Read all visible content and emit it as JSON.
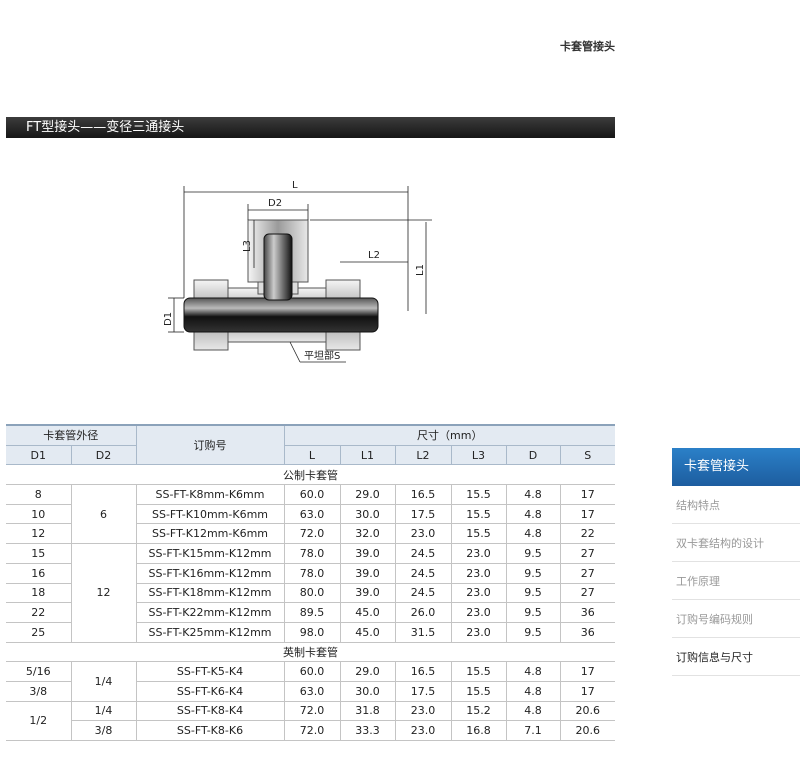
{
  "page_title": "卡套管接头",
  "banner_title": "FT型接头——变径三通接头",
  "drawing_labels": {
    "L": "L",
    "D2": "D2",
    "L3": "L3",
    "L2": "L2",
    "L1": "L1",
    "D1": "D1",
    "S": "平坦部S"
  },
  "table": {
    "header": {
      "tube_od": "卡套管外径",
      "order_no": "订购号",
      "size": "尺寸（mm）",
      "d1": "D1",
      "d2": "D2",
      "l": "L",
      "l1": "L1",
      "l2": "L2",
      "l3": "L3",
      "d": "D",
      "s": "S"
    },
    "metric_label": "公制卡套管",
    "imperial_label": "英制卡套管",
    "metric_rows": [
      {
        "d1": "8",
        "order": "SS-FT-K8mm-K6mm",
        "l": "60.0",
        "l1": "29.0",
        "l2": "16.5",
        "l3": "15.5",
        "d": "4.8",
        "s": "17"
      },
      {
        "d1": "10",
        "order": "SS-FT-K10mm-K6mm",
        "l": "63.0",
        "l1": "30.0",
        "l2": "17.5",
        "l3": "15.5",
        "d": "4.8",
        "s": "17"
      },
      {
        "d1": "12",
        "order": "SS-FT-K12mm-K6mm",
        "l": "72.0",
        "l1": "32.0",
        "l2": "23.0",
        "l3": "15.5",
        "d": "4.8",
        "s": "22"
      },
      {
        "d1": "15",
        "order": "SS-FT-K15mm-K12mm",
        "l": "78.0",
        "l1": "39.0",
        "l2": "24.5",
        "l3": "23.0",
        "d": "9.5",
        "s": "27"
      },
      {
        "d1": "16",
        "order": "SS-FT-K16mm-K12mm",
        "l": "78.0",
        "l1": "39.0",
        "l2": "24.5",
        "l3": "23.0",
        "d": "9.5",
        "s": "27"
      },
      {
        "d1": "18",
        "order": "SS-FT-K18mm-K12mm",
        "l": "80.0",
        "l1": "39.0",
        "l2": "24.5",
        "l3": "23.0",
        "d": "9.5",
        "s": "27"
      },
      {
        "d1": "22",
        "order": "SS-FT-K22mm-K12mm",
        "l": "89.5",
        "l1": "45.0",
        "l2": "26.0",
        "l3": "23.0",
        "d": "9.5",
        "s": "36"
      },
      {
        "d1": "25",
        "order": "SS-FT-K25mm-K12mm",
        "l": "98.0",
        "l1": "45.0",
        "l2": "31.5",
        "l3": "23.0",
        "d": "9.5",
        "s": "36"
      }
    ],
    "metric_d2_groups": [
      "6",
      "12"
    ],
    "imperial_rows": [
      {
        "order": "SS-FT-K5-K4",
        "l": "60.0",
        "l1": "29.0",
        "l2": "16.5",
        "l3": "15.5",
        "d": "4.8",
        "s": "17"
      },
      {
        "order": "SS-FT-K6-K4",
        "l": "63.0",
        "l1": "30.0",
        "l2": "17.5",
        "l3": "15.5",
        "d": "4.8",
        "s": "17"
      },
      {
        "order": "SS-FT-K8-K4",
        "l": "72.0",
        "l1": "31.8",
        "l2": "23.0",
        "l3": "15.2",
        "d": "4.8",
        "s": "20.6"
      },
      {
        "order": "SS-FT-K8-K6",
        "l": "72.0",
        "l1": "33.3",
        "l2": "23.0",
        "l3": "16.8",
        "d": "7.1",
        "s": "20.6"
      }
    ],
    "imperial_d1": [
      "5/16",
      "3/8",
      "1/2"
    ],
    "imperial_d2": [
      "1/4",
      "1/4",
      "3/8"
    ]
  },
  "sidebar": {
    "active": "卡套管接头",
    "items": [
      "结构特点",
      "双卡套结构的设计",
      "工作原理",
      "订购号编码规则",
      "订购信息与尺寸"
    ]
  },
  "colors": {
    "banner": "#222222",
    "header_bg": "#e3eaf2",
    "sidebar_active": "#2272b8"
  }
}
